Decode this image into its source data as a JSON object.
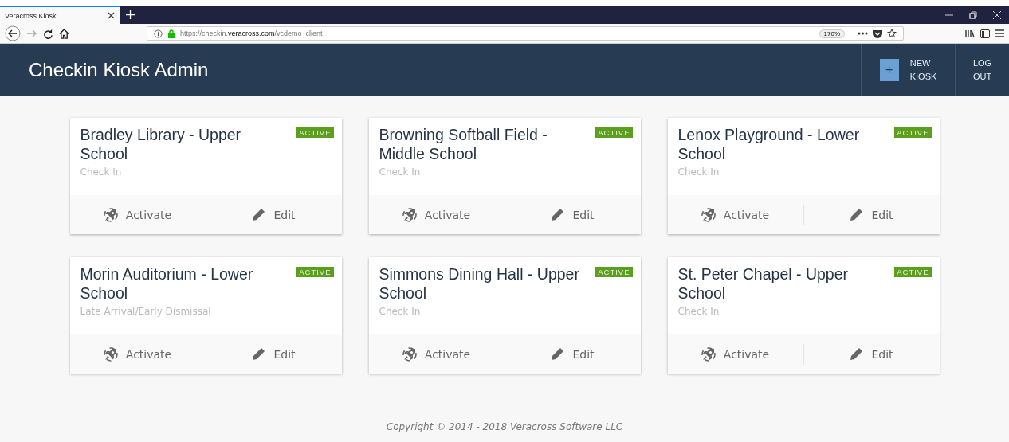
{
  "browser": {
    "tab_title": "Veracross Kiosk",
    "url": {
      "prefix": "https://checkin.",
      "domain": "veracross.com",
      "path": "/vcdemo_client"
    },
    "zoom": "170%"
  },
  "header": {
    "title": "Checkin Kiosk Admin",
    "new_button": {
      "icon": "+",
      "line1": "NEW",
      "line2": "KIOSK"
    },
    "logout_button": {
      "line1": "LOG",
      "line2": "OUT"
    }
  },
  "kiosks": [
    {
      "name": "Bradley Library - Upper School",
      "status": "ACTIVE",
      "type": "Check In",
      "actions": [
        "Activate",
        "Edit"
      ]
    },
    {
      "name": "Browning Softball Field - Middle School",
      "status": "ACTIVE",
      "type": "Check In",
      "actions": [
        "Activate",
        "Edit"
      ]
    },
    {
      "name": "Lenox Playground - Lower School",
      "status": "ACTIVE",
      "type": "Check In",
      "actions": [
        "Activate",
        "Edit"
      ]
    },
    {
      "name": "Morin Auditorium - Lower School",
      "status": "ACTIVE",
      "type": "Late Arrival/Early Dismissal",
      "actions": [
        "Activate",
        "Edit"
      ]
    },
    {
      "name": "Simmons Dining Hall - Upper School",
      "status": "ACTIVE",
      "type": "Check In",
      "actions": [
        "Activate",
        "Edit"
      ]
    },
    {
      "name": "St. Peter Chapel - Upper School",
      "status": "ACTIVE",
      "type": "Check In",
      "actions": [
        "Activate",
        "Edit"
      ]
    }
  ],
  "footer": "Copyright © 2014 - 2018 Veracross Software LLC"
}
